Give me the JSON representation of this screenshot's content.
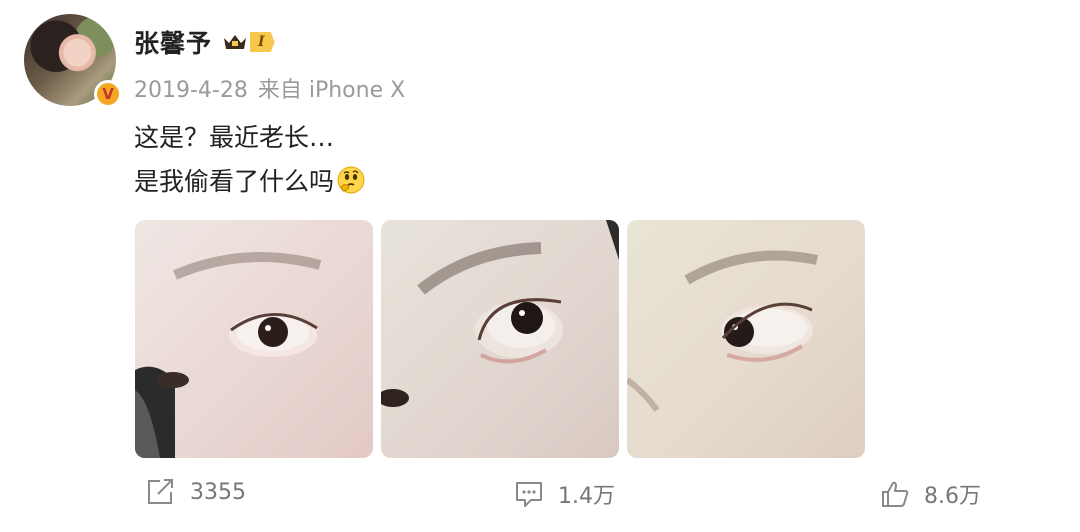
{
  "user": {
    "name": "张馨予",
    "vip_level": "I",
    "verified_badge": "V"
  },
  "post": {
    "date": "2019-4-28",
    "source": "来自 iPhone X",
    "text_line1": "这是？最近老长…",
    "text_line2": "是我偷看了什么吗",
    "emoji": "thinking-face-icon",
    "images": [
      {
        "alt": "close-up eye photo 1"
      },
      {
        "alt": "close-up eye photo 2"
      },
      {
        "alt": "close-up eye photo 3"
      }
    ]
  },
  "actions": {
    "repost_count": "3355",
    "comment_count": "1.4万",
    "like_count": "8.6万"
  },
  "colors": {
    "accent_badge": "#f5a623",
    "vip_gold": "#f6c84c",
    "meta_gray": "#9a9a9a"
  }
}
